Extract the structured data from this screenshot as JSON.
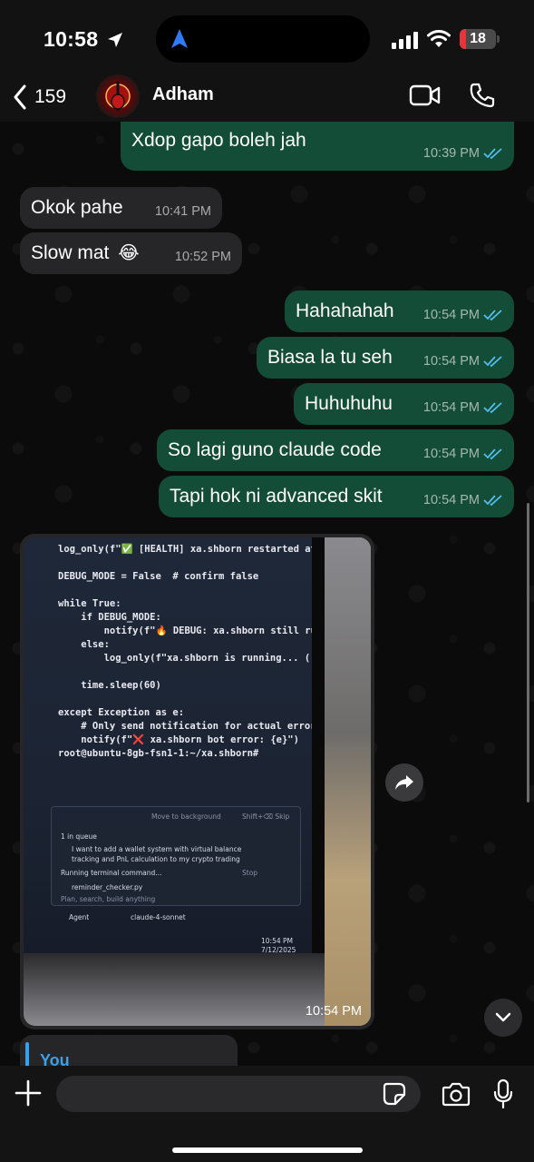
{
  "status_bar": {
    "time": "10:58",
    "battery": "18",
    "battery_percent": 18,
    "battery_color": "#e5343a"
  },
  "header": {
    "back_count": "159",
    "contact_name": "Adham"
  },
  "messages": [
    {
      "text": "Xdop gapo boleh jah",
      "time": "10:39 PM",
      "direction": "out"
    },
    {
      "text": "Okok pahe",
      "time": "10:41 PM",
      "direction": "in"
    },
    {
      "text": "Slow mat",
      "emoji": "😂",
      "time": "10:52 PM",
      "direction": "in"
    },
    {
      "text": "Hahahahah",
      "time": "10:54 PM",
      "direction": "out"
    },
    {
      "text": "Biasa la tu seh",
      "time": "10:54 PM",
      "direction": "out"
    },
    {
      "text": "Huhuhuhu",
      "time": "10:54 PM",
      "direction": "out"
    },
    {
      "text": "So lagi guno claude code",
      "time": "10:54 PM",
      "direction": "out"
    },
    {
      "text": "Tapi hok ni advanced skit",
      "time": "10:54 PM",
      "direction": "out"
    }
  ],
  "photo_message": {
    "time": "10:54 PM",
    "code_lines": [
      "log_only(f\"✅ [HEALTH] xa.shborn restarted at",
      "",
      "DEBUG_MODE = False  # confirm false",
      "",
      "while True:",
      "    if DEBUG_MODE:",
      "        notify(f\"🔥 DEBUG: xa.shborn still ru",
      "    else:",
      "        log_only(f\"xa.shborn is running... (",
      "",
      "    time.sleep(60)",
      "",
      "except Exception as e:",
      "    # Only send notification for actual errors/pr",
      "    notify(f\"❌ xa.shborn bot error: {e}\")",
      "root@ubuntu-8gb-fsn1-1:~/xa.shborn#"
    ],
    "terminal_panel": {
      "move_to_background": "Move to background",
      "skip": "Shift+⌫ Skip",
      "queue": "1 in queue",
      "task": "I want to add a wallet system with virtual balance",
      "task2": "tracking and PnL calculation to my crypto trading",
      "running": "Running terminal command...",
      "stop": "Stop",
      "file": "reminder_checker.py",
      "placeholder": "Plan, search, build anything",
      "agent": "Agent",
      "model": "claude-4-sonnet",
      "clock": "10:54 PM",
      "date": "7/12/2025"
    }
  },
  "reply_preview": {
    "sender": "You"
  },
  "input_bar": {
    "placeholder": ""
  },
  "colors": {
    "outgoing_bubble": "#144d37",
    "incoming_bubble": "#262628",
    "read_ticks": "#53bdeb",
    "reply_accent": "#3aa0e8"
  }
}
